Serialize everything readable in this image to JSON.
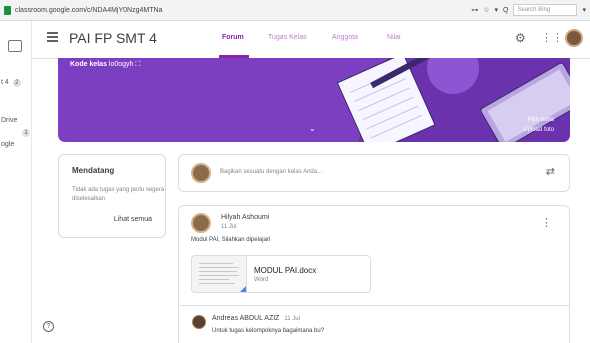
{
  "browser": {
    "url": "classroom.google.com/c/NDA4MjY0Nzg4MTNa",
    "bookmark_icon": "☆",
    "search_placeholder": "Search Bing"
  },
  "side": {
    "tab_label": "",
    "items": [
      {
        "text": "t 4",
        "badge": "2"
      },
      {
        "text": "Drive",
        "badge": ""
      },
      {
        "text": "",
        "badge": "1"
      },
      {
        "text": "ogle",
        "badge": ""
      }
    ]
  },
  "header": {
    "title": "PAI FP SMT 4",
    "tabs": [
      "Forum",
      "Tugas Kelas",
      "Anggota",
      "Nilai"
    ],
    "icons": [
      "settings-icon",
      "apps-grid-icon",
      "account-avatar"
    ]
  },
  "banner": {
    "code_label": "Kode kelas",
    "code_value": "lo0ogyh",
    "select_theme": "Pilih tema",
    "upload_photo": "Upload foto",
    "accent": "#7c3fc2"
  },
  "upcoming": {
    "title": "Mendatang",
    "description": "Tidak ada tugas yang perlu segera diselesaikan",
    "view_all": "Lihat semua"
  },
  "share": {
    "placeholder": "Bagikan sesuatu dengan kelas Anda..."
  },
  "post": {
    "author": "Hilyah Ashoumi",
    "date": "11 Jul",
    "body": "Modul PAI, Silahkan dipelajari",
    "attachment": {
      "name": "MODUL PAI.docx",
      "type": "Word"
    },
    "comment": {
      "author": "Andreas ABDUL AZIZ",
      "date": "11 Jul",
      "text": "Untuk tugas kelompoknya bagaimana bu?"
    }
  },
  "colors": {
    "tab_active": "#8e24aa",
    "tab_inactive": "#c27bd1",
    "banner": "#7c3fc2",
    "word_blue": "#4285f4"
  }
}
